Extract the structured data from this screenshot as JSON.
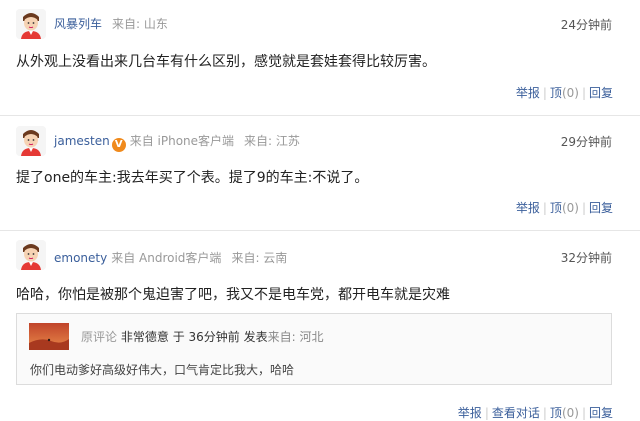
{
  "comments": [
    {
      "username": "风暴列车",
      "client": "",
      "location": "来自: 山东",
      "time": "24分钟前",
      "text": "从外观上没看出来几台车有什么区别，感觉就是套娃套得比较厉害。",
      "actions": {
        "report": "举报",
        "up": "顶",
        "up_count": "(0)",
        "reply": "回复"
      }
    },
    {
      "username": "jamesten",
      "client": "来自 iPhone客户端",
      "location": "来自: 江苏",
      "time": "29分钟前",
      "text": "提了one的车主:我去年买了个表。提了9的车主:不说了。",
      "actions": {
        "report": "举报",
        "up": "顶",
        "up_count": "(0)",
        "reply": "回复"
      }
    },
    {
      "username": "emonety",
      "client": "来自 Android客户端",
      "location": "来自: 云南",
      "time": "32分钟前",
      "text": "哈哈，你怕是被那个鬼迫害了吧，我又不是电车党，都开电车就是灾难",
      "quote": {
        "label": "原评论",
        "username": "非常德意",
        "time": "于 36分钟前 发表",
        "location": "来自: 河北",
        "text": "你们电动爹好高级好伟大，口气肯定比我大，哈哈"
      },
      "actions": {
        "report": "举报",
        "view": "查看对话",
        "up": "顶",
        "up_count": "(0)",
        "reply": "回复"
      }
    }
  ],
  "colors": {
    "link": "#3b5f9b",
    "muted": "#999999",
    "badge": "#f08a1c",
    "text": "#222222"
  },
  "icons": {
    "avatar": "cartoon-man-avatar-icon",
    "verified": "v-badge-icon"
  }
}
